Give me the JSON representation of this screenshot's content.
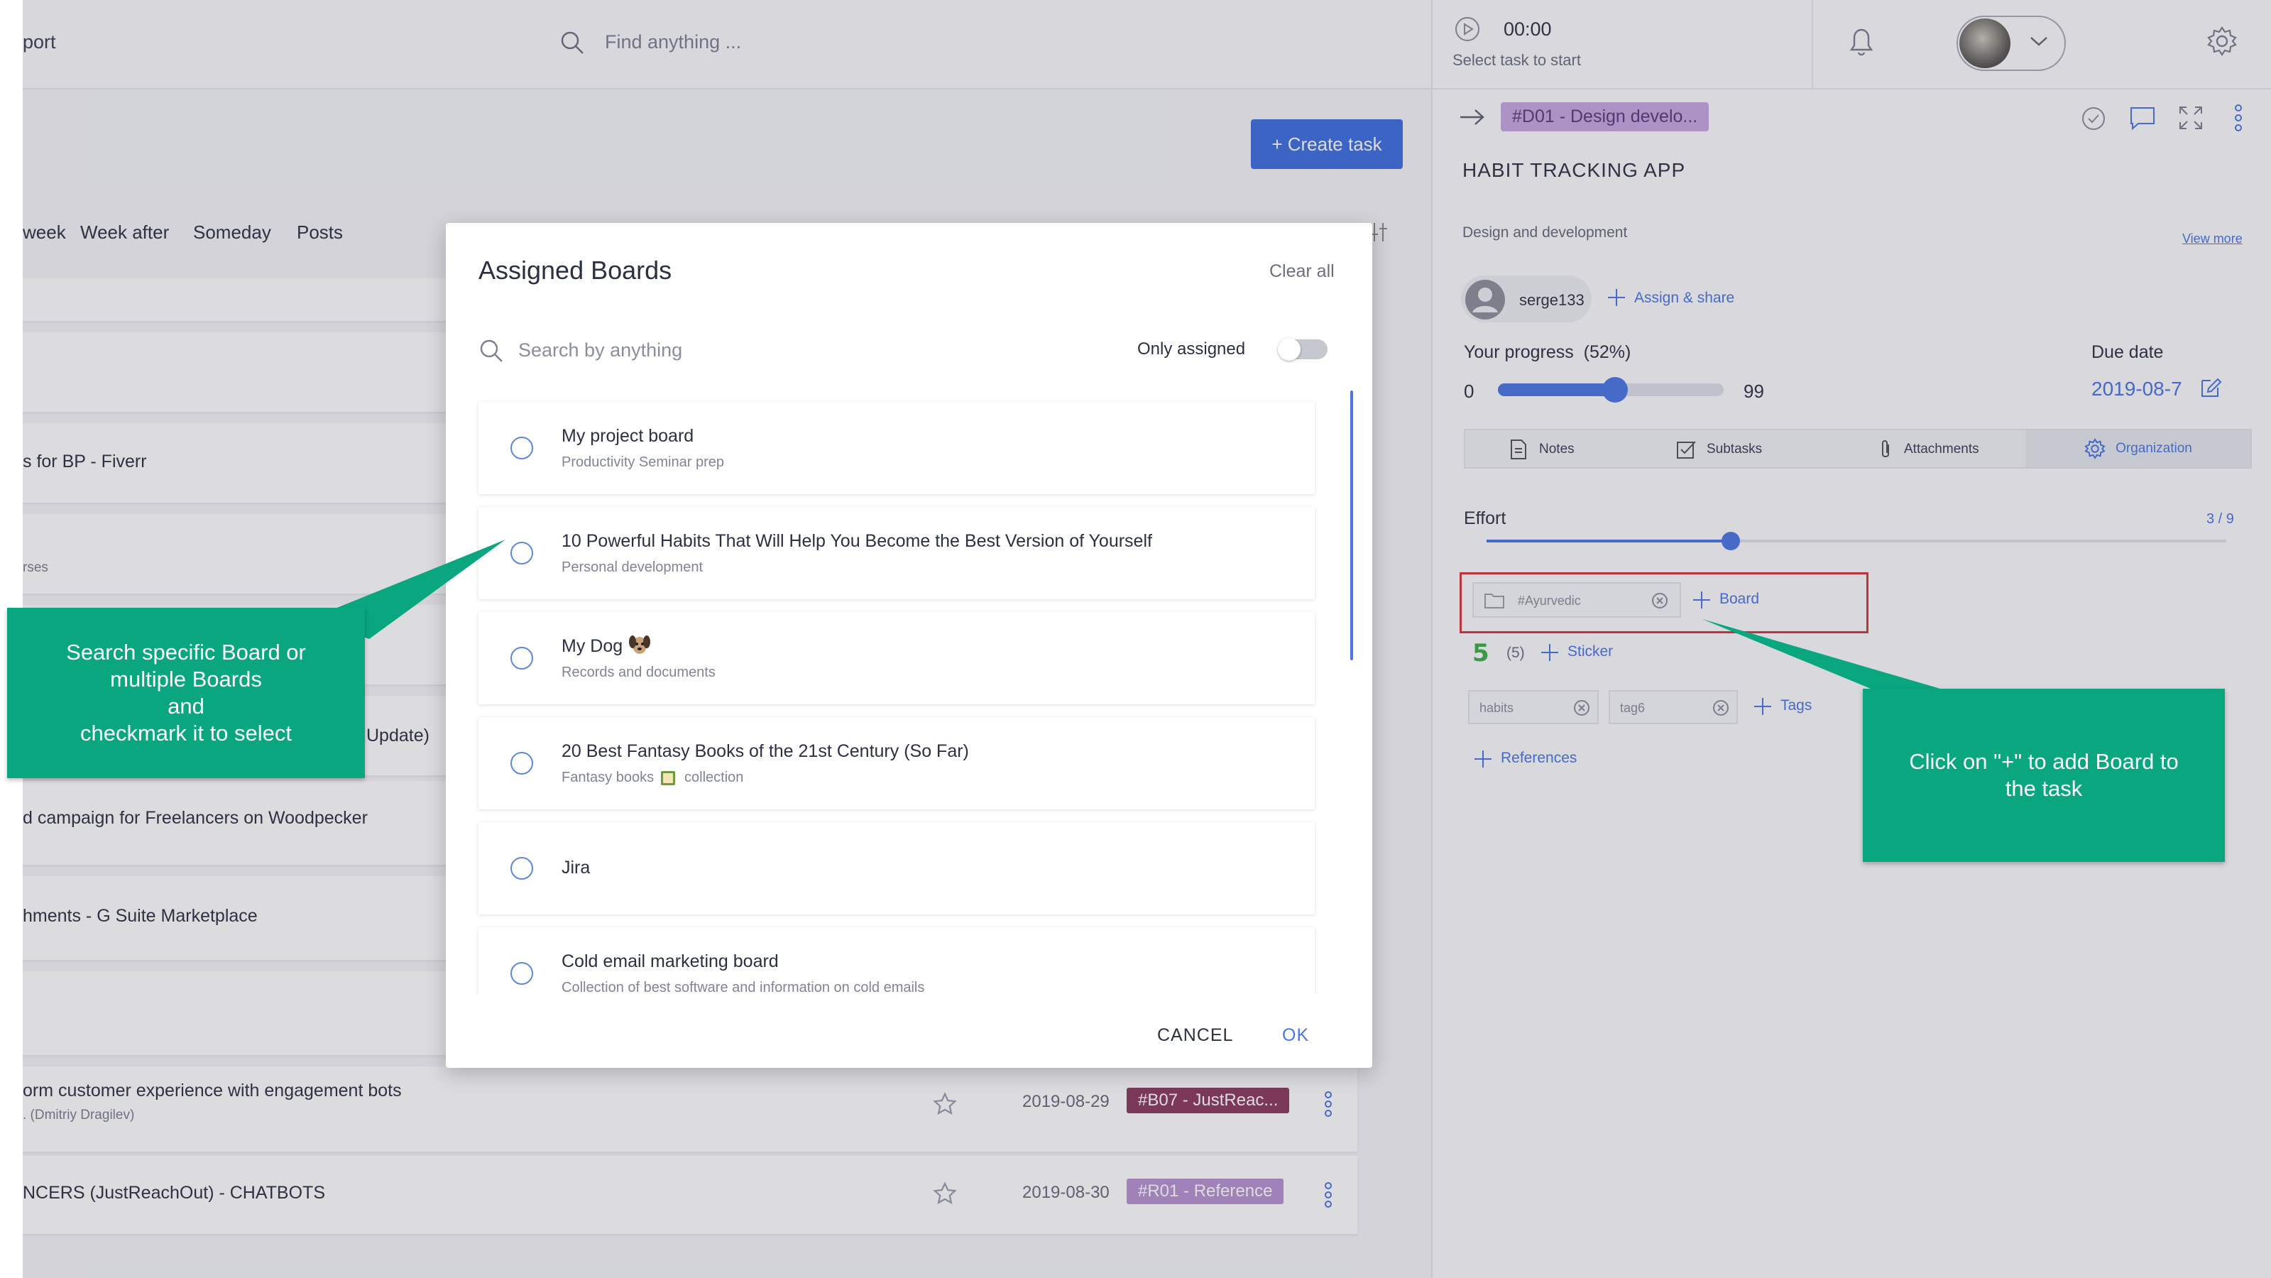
{
  "topbar": {
    "app_label": "port",
    "search_placeholder": "Find anything ...",
    "timer": "00:00",
    "timer_hint": "Select task to start"
  },
  "create_task_label": "+ Create task",
  "nav_tabs": [
    "week",
    "Week after",
    "Someday",
    "Posts"
  ],
  "list": {
    "row1_title": "s for BP - Fiverr",
    "row2_sub": "rses",
    "row3_title": "Update)",
    "row4_title": "d campaign for Freelancers on Woodpecker",
    "row5_title": "hments - G Suite Marketplace",
    "row6_title": "orm customer experience with engagement bots",
    "row6_sub": ". (Dmitriy Dragilev)",
    "row6_date": "2019-08-29",
    "row6_tag": "#B07 - JustReac...",
    "row7_title": "NCERS (JustReachOut) - CHATBOTS",
    "row7_date": "2019-08-30",
    "row7_tag": "#R01 - Reference"
  },
  "modal": {
    "title": "Assigned Boards",
    "clear_all": "Clear all",
    "search_placeholder": "Search by anything",
    "only_assigned": "Only assigned",
    "boards": [
      {
        "title": "My project board",
        "subtitle": "Productivity Seminar prep"
      },
      {
        "title": "10 Powerful Habits That Will Help You Become the Best Version of Yourself",
        "subtitle": "Personal development"
      },
      {
        "title": "My Dog",
        "subtitle": "Records and documents"
      },
      {
        "title": "20 Best Fantasy Books of the 21st Century (So Far)",
        "subtitle_a": "Fantasy books",
        "subtitle_b": "collection"
      },
      {
        "title": "Jira",
        "subtitle": ""
      },
      {
        "title": "Cold email marketing board",
        "subtitle": "Collection of best software and information on cold emails"
      }
    ],
    "cancel": "CANCEL",
    "ok": "OK"
  },
  "task": {
    "tag": "#D01 - Design develo...",
    "title": "HABIT TRACKING APP",
    "category": "Design and development",
    "view_more": "View more",
    "user": "serge133",
    "assign_share": "Assign & share",
    "progress_label": "Your progress  (52%)",
    "progress": 0.52,
    "progress_min": "0",
    "progress_max": "99",
    "due_label": "Due date",
    "due_date": "2019-08-7",
    "tabs": [
      "Notes",
      "Subtasks",
      "Attachments",
      "Organization"
    ],
    "effort_label": "Effort",
    "effort_value": "3 / 9",
    "effort": 0.33,
    "board_chip": "#Ayurvedic",
    "board_add": "Board",
    "sticker_count": "(5)",
    "sticker_add": "Sticker",
    "tags": [
      "habits",
      "tag6"
    ],
    "tags_add": "Tags",
    "references_add": "References"
  },
  "callouts": {
    "left_lines": [
      "Search specific Board or",
      "multiple Boards",
      "and",
      "checkmark it to select"
    ],
    "right_lines": [
      "Click on \"+\" to add Board to",
      "the task"
    ]
  },
  "colors": {
    "accent": "#4a76e3",
    "callout": "#0aa67f",
    "highlight_box": "#d9343a",
    "tag_purple": "#b792d0",
    "tag_maroon": "#8c3a5e"
  }
}
